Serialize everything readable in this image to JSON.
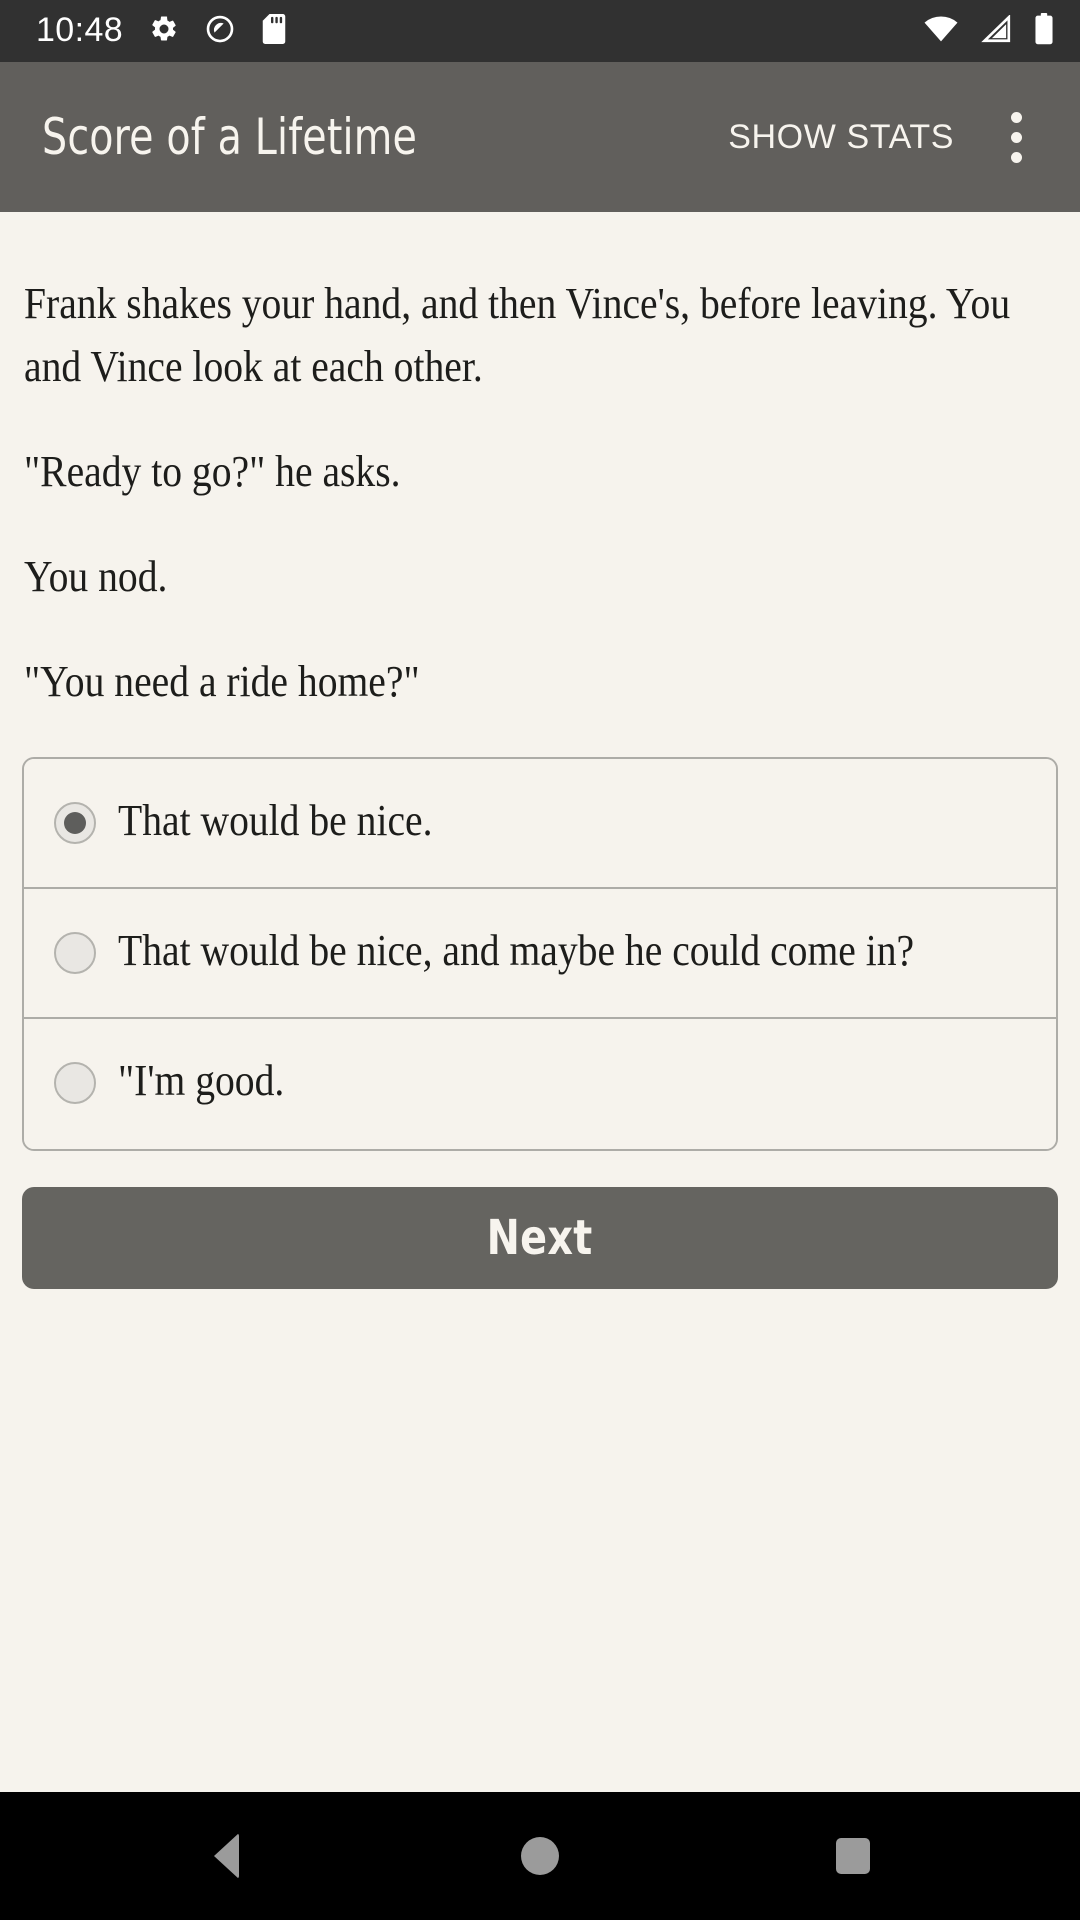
{
  "status_bar": {
    "time": "10:48",
    "left_icons": [
      "settings-gear-icon",
      "do-not-disturb-icon",
      "sd-card-icon"
    ],
    "right_icons": [
      "wifi-icon",
      "cellular-signal-icon",
      "battery-icon"
    ],
    "background_color": "#313131",
    "foreground_color": "#ffffff"
  },
  "app_bar": {
    "title": "Score of a Lifetime",
    "action_label": "SHOW STATS",
    "overflow_icon": "more-vert-icon",
    "background_color": "#615f5c",
    "text_color": "#f7f4ee"
  },
  "story": {
    "paragraphs": [
      "Frank shakes your hand, and then Vince's, before leaving. You and Vince look at each other.",
      "\"Ready to go?\" he asks.",
      "You nod.",
      "\"You need a ride home?\""
    ],
    "text_color": "#1d1d1b"
  },
  "choices": {
    "selected_index": 0,
    "border_color": "#adaca7",
    "radio_fill": "#e9e7e3",
    "radio_dot_color": "#5e5e5c",
    "options": [
      {
        "label": "That would be nice.",
        "selected": true
      },
      {
        "label": "That would be nice, and maybe he could come in?",
        "selected": false
      },
      {
        "label": "\"I'm good.",
        "selected": false
      }
    ]
  },
  "next_button": {
    "label": "Next",
    "background_color": "#656460",
    "text_color": "#f7f4ee"
  },
  "nav_bar": {
    "background_color": "#000000",
    "icon_color": "#9b9b9b",
    "buttons": [
      {
        "name": "back-icon"
      },
      {
        "name": "home-icon"
      },
      {
        "name": "recents-icon"
      }
    ]
  },
  "page": {
    "background_color": "#f6f3ed"
  }
}
